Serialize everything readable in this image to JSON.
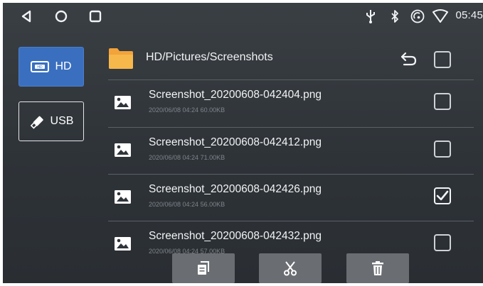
{
  "status_bar": {
    "time": "05:45",
    "nav_icons": [
      "back-icon",
      "home-icon",
      "recents-icon"
    ],
    "status_icons": [
      "usb-icon",
      "bluetooth-icon",
      "hotspot-icon",
      "wifi-icon"
    ]
  },
  "sources": [
    {
      "label": "HD",
      "icon": "hard-drive-icon",
      "selected": true
    },
    {
      "label": "USB",
      "icon": "usb-stick-icon",
      "selected": false
    }
  ],
  "header": {
    "path": "HD/Pictures/Screenshots",
    "select_all_checked": false
  },
  "files": [
    {
      "name": "Screenshot_20200608-042404.png",
      "meta": "2020/06/08 04:24  60.00KB",
      "checked": false
    },
    {
      "name": "Screenshot_20200608-042412.png",
      "meta": "2020/06/08 04:24  71.00KB",
      "checked": false
    },
    {
      "name": "Screenshot_20200608-042426.png",
      "meta": "2020/06/08 04:24  56.00KB",
      "checked": true
    },
    {
      "name": "Screenshot_20200608-042432.png",
      "meta": "2020/06/08 04:24  57.00KB",
      "checked": false
    }
  ],
  "actions": [
    {
      "icon": "copy-icon"
    },
    {
      "icon": "cut-icon"
    },
    {
      "icon": "delete-icon"
    }
  ],
  "colors": {
    "accent": "#3a6fbf",
    "background": "#32373c",
    "action_button": "#6a6e72"
  }
}
